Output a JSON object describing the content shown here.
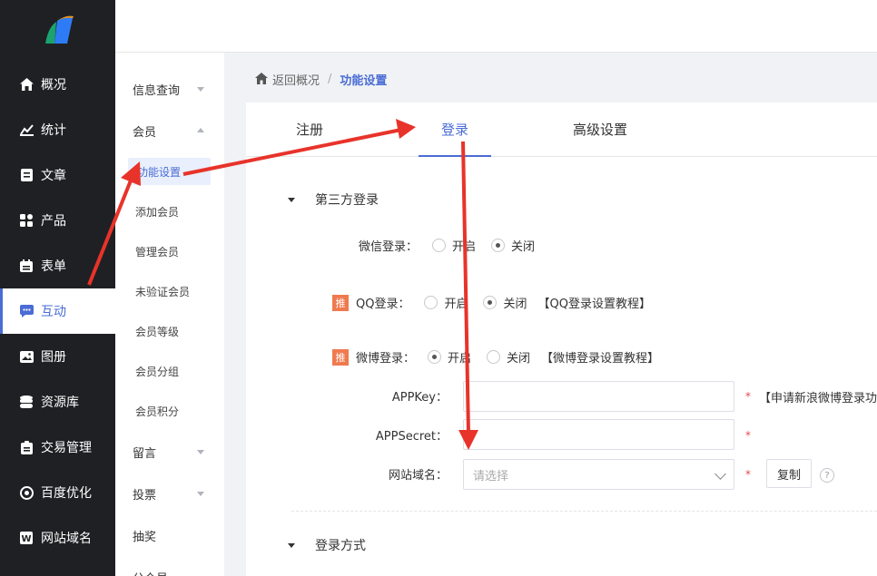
{
  "nav": {
    "items": [
      {
        "label": "概况",
        "icon": "home-icon"
      },
      {
        "label": "统计",
        "icon": "chart-icon"
      },
      {
        "label": "文章",
        "icon": "article-icon"
      },
      {
        "label": "产品",
        "icon": "product-icon"
      },
      {
        "label": "表单",
        "icon": "form-icon"
      },
      {
        "label": "互动",
        "icon": "chat-icon"
      },
      {
        "label": "图册",
        "icon": "album-icon"
      },
      {
        "label": "资源库",
        "icon": "database-icon"
      },
      {
        "label": "交易管理",
        "icon": "trade-icon"
      },
      {
        "label": "百度优化",
        "icon": "seo-icon"
      },
      {
        "label": "网站域名",
        "icon": "domain-icon"
      }
    ],
    "active_index": 5
  },
  "subnav": {
    "groups": [
      {
        "label": "信息查询"
      },
      {
        "label": "会员"
      },
      {
        "label": "留言"
      },
      {
        "label": "投票"
      },
      {
        "label": "抽奖"
      },
      {
        "label": "公众号"
      }
    ],
    "member_children": [
      "功能设置",
      "添加会员",
      "管理会员",
      "未验证会员",
      "会员等级",
      "会员分组",
      "会员积分"
    ]
  },
  "breadcrumb": {
    "back": "返回概况",
    "separator": "/",
    "current": "功能设置"
  },
  "tabs": [
    {
      "label": "注册"
    },
    {
      "label": "登录"
    },
    {
      "label": "高级设置"
    }
  ],
  "third_party": {
    "title": "第三方登录",
    "wechat": {
      "label": "微信登录：",
      "on": "开启",
      "off": "关闭",
      "value": "off"
    },
    "qq": {
      "badge": "推",
      "label": "QQ登录：",
      "on": "开启",
      "off": "关闭",
      "value": "off",
      "link": "【QQ登录设置教程】"
    },
    "weibo": {
      "badge": "推",
      "label": "微博登录：",
      "on": "开启",
      "off": "关闭",
      "value": "on",
      "link": "【微博登录设置教程】"
    },
    "appkey": {
      "label": "APPKey：",
      "value": "",
      "required": "*",
      "note": "【申请新浪微博登录功"
    },
    "appsecret": {
      "label": "APPSecret：",
      "value": "",
      "required": "*"
    },
    "domain": {
      "label": "网站域名：",
      "placeholder": "请选择",
      "required": "*",
      "copy": "复制",
      "help": "?"
    }
  },
  "login_method": {
    "title": "登录方式"
  },
  "colors": {
    "accent": "#4a6cd4",
    "nav_bg": "#1f2023",
    "badge": "#ef7a4f",
    "arrow": "#e8332a"
  }
}
